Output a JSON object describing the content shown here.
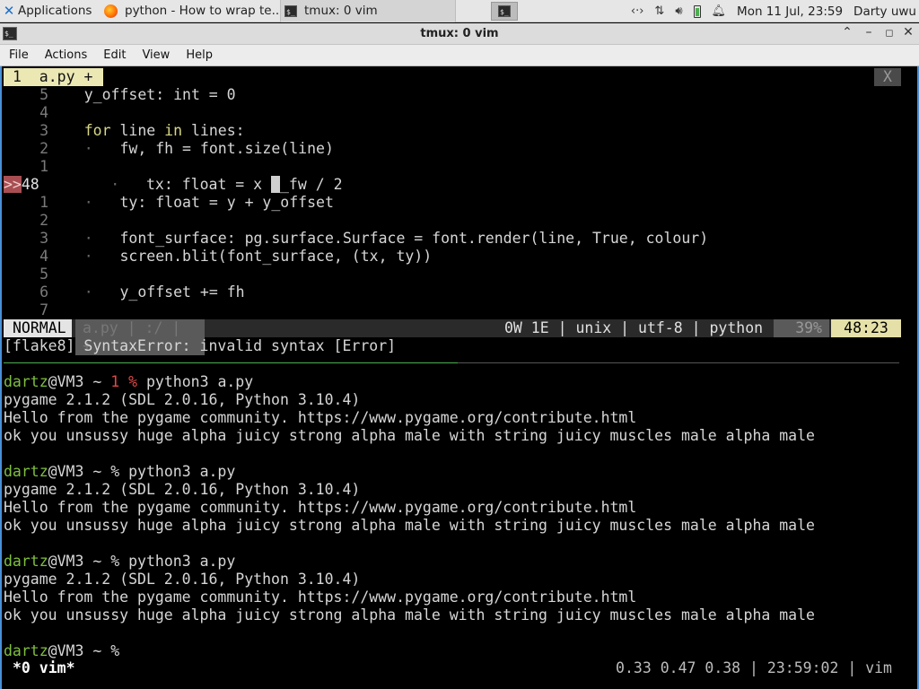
{
  "panel": {
    "applications": "Applications",
    "tasks": [
      {
        "label": "python - How to wrap te..."
      },
      {
        "label": "tmux: 0 vim"
      }
    ],
    "clock": "Mon 11 Jul, 23:59",
    "user": "Darty uwu"
  },
  "window": {
    "title": "tmux: 0 vim"
  },
  "menubar": [
    "File",
    "Actions",
    "Edit",
    "View",
    "Help"
  ],
  "vim": {
    "tab_label": "1  a.py +",
    "tab_close": "X",
    "lines": [
      {
        "num": "5",
        "code": "    y_offset: int = 0"
      },
      {
        "num": "4",
        "code": ""
      },
      {
        "num": "3",
        "code": "    for line in lines:"
      },
      {
        "num": "2",
        "code": "        fw, fh = font.size(line)"
      },
      {
        "num": "1",
        "code": ""
      },
      {
        "num": "48",
        "code": "        tx: float = x _fw / 2"
      },
      {
        "num": "1",
        "code": "        ty: float = y + y_offset"
      },
      {
        "num": "2",
        "code": ""
      },
      {
        "num": "3",
        "code": "        font_surface: pg.surface.Surface = font.render(line, True, colour)"
      },
      {
        "num": "4",
        "code": "        screen.blit(font_surface, (tx, ty))"
      },
      {
        "num": "5",
        "code": ""
      },
      {
        "num": "6",
        "code": "        y_offset += fh"
      },
      {
        "num": "7",
        "code": ""
      }
    ],
    "sign": ">>",
    "status": {
      "mode": "NORMAL",
      "file": "a.py |  :/  |  +",
      "right": "0W 1E  |  unix  |  utf-8  |  python",
      "percent": "39%",
      "position": "48:23"
    },
    "message": "[flake8] SyntaxError: invalid syntax [Error]"
  },
  "shell": {
    "user": "dartz",
    "host": "@VM3 ~ ",
    "error_code": "1 ",
    "command": "python3 a.py",
    "output": [
      "pygame 2.1.2 (SDL 2.0.16, Python 3.10.4)",
      "Hello from the pygame community. https://www.pygame.org/contribute.html",
      "ok you unsussy huge alpha juicy strong alpha male with string juicy muscles male alpha male"
    ],
    "final_prompt": "% "
  },
  "tmux": {
    "window": "*0 vim*",
    "status_right": "0.33 0.47 0.38  |  23:59:02  |  vim"
  }
}
